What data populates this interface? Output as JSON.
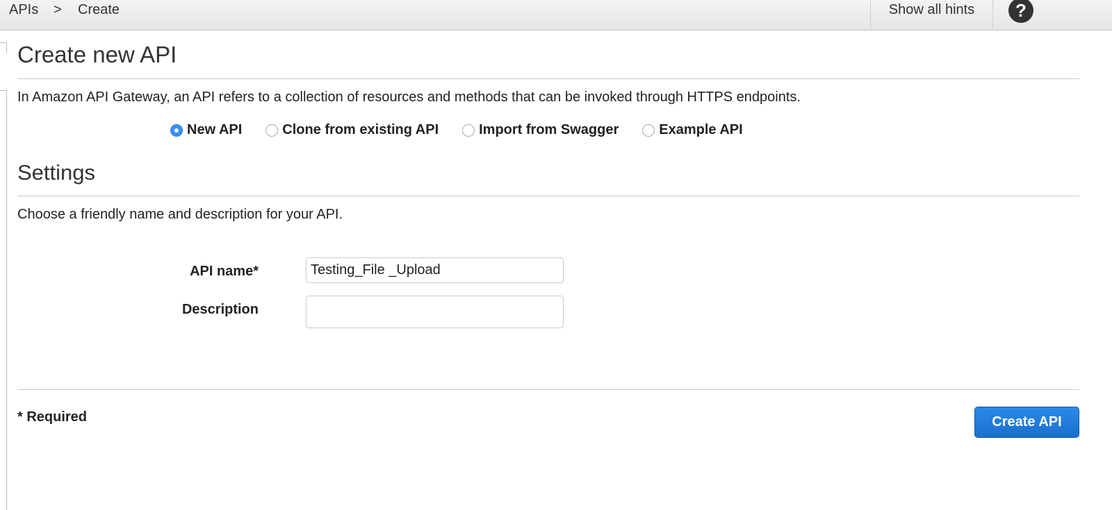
{
  "breadcrumb": {
    "root": "APIs",
    "separator": ">",
    "current": "Create"
  },
  "header": {
    "hints_label": "Show all hints",
    "help_icon": "?"
  },
  "page": {
    "title": "Create new API",
    "intro": "In Amazon API Gateway, an API refers to a collection of resources and methods that can be invoked through HTTPS endpoints.",
    "options": [
      {
        "label": "New API",
        "selected": true
      },
      {
        "label": "Clone from existing API",
        "selected": false
      },
      {
        "label": "Import from Swagger",
        "selected": false
      },
      {
        "label": "Example API",
        "selected": false
      }
    ]
  },
  "settings": {
    "title": "Settings",
    "subtitle": "Choose a friendly name and description for your API.",
    "api_name_label": "API name*",
    "api_name_value": "Testing_File _Upload",
    "description_label": "Description",
    "description_value": ""
  },
  "footer": {
    "required_note": "* Required",
    "create_button": "Create API"
  },
  "colors": {
    "accent": "#1f7ad9"
  }
}
